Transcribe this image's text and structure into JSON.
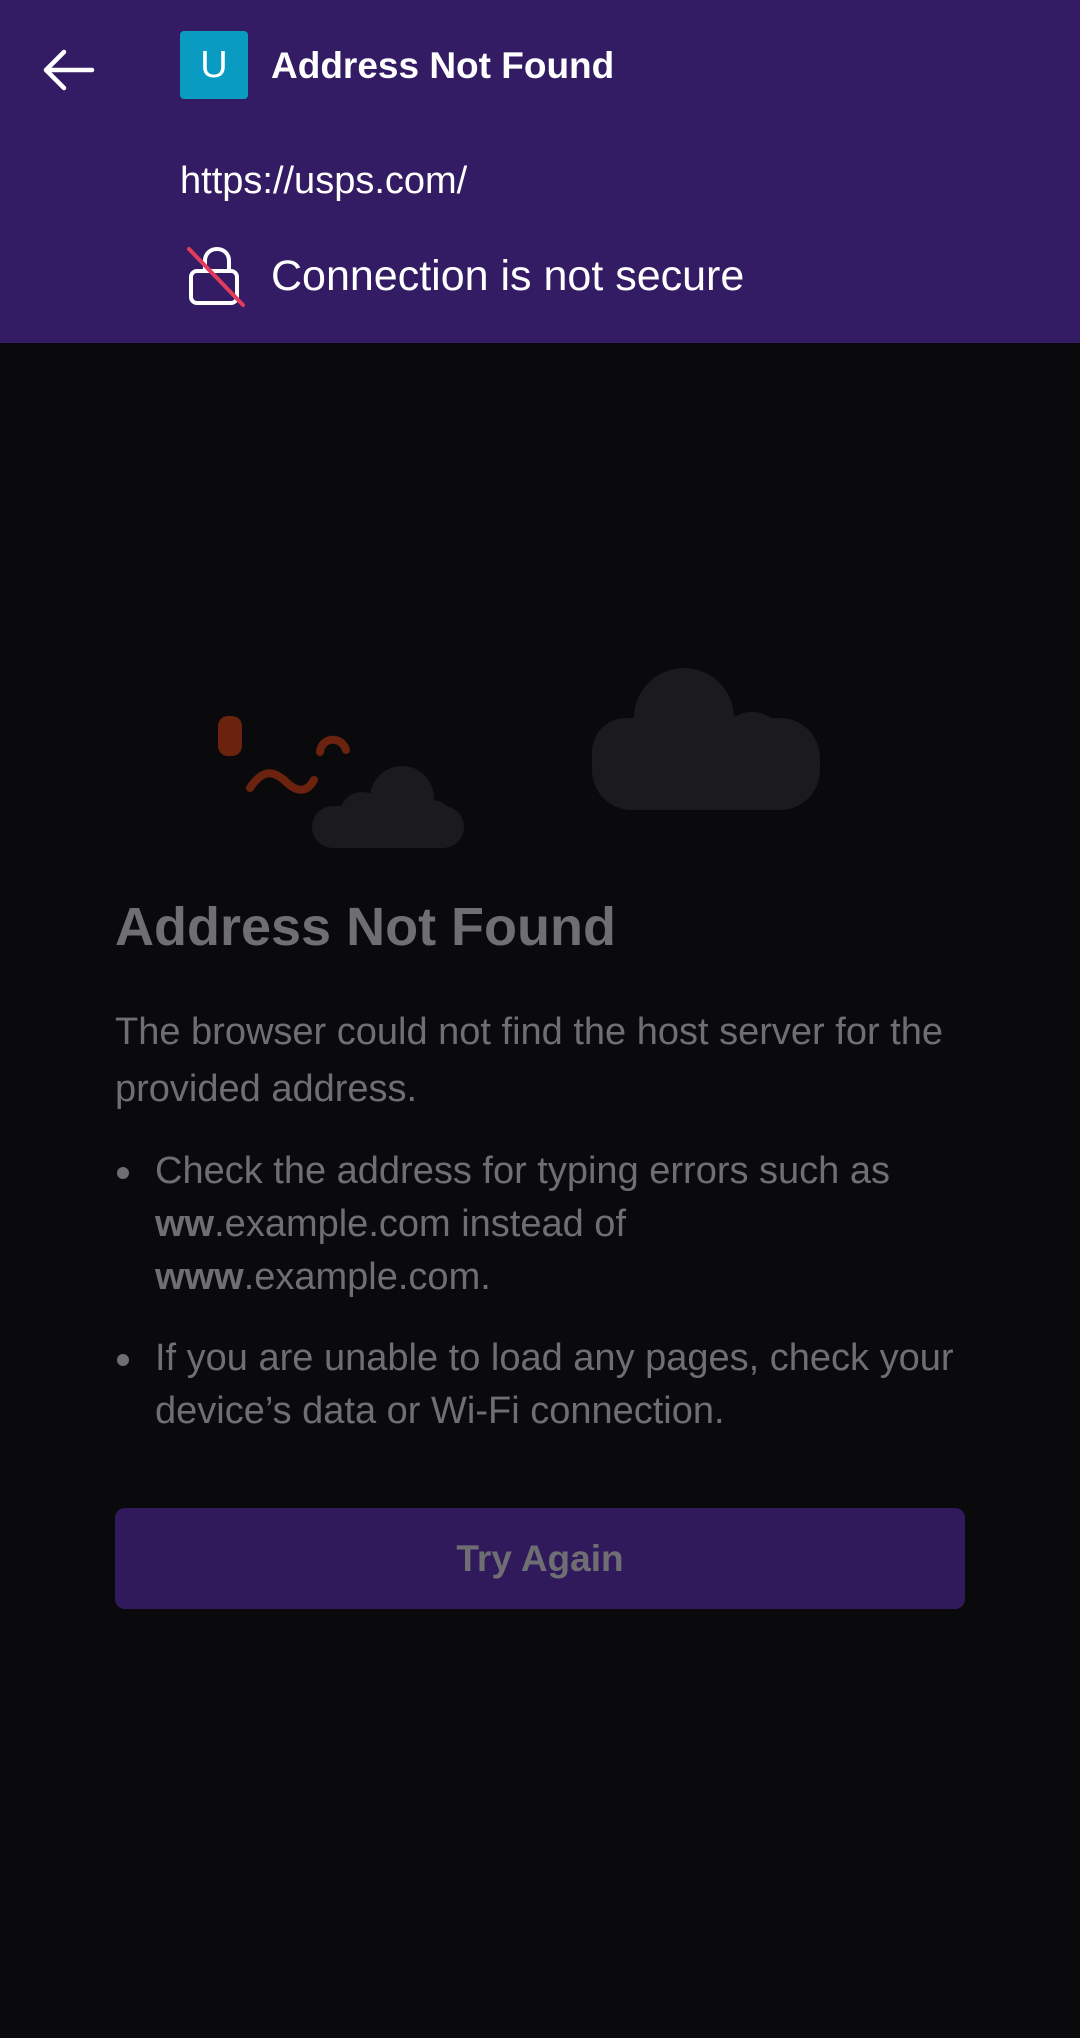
{
  "header": {
    "back_icon": "arrow-left-icon",
    "site_icon_letter": "U",
    "site_icon_color": "#0a9bc3",
    "title": "Address Not Found",
    "url": "https://usps.com/",
    "security_icon": "insecure-lock-icon",
    "security_text": "Connection is not secure",
    "background_color": "#331c63"
  },
  "error_page": {
    "title": "Address Not Found",
    "description": "The browser could not find the host server for the provided address.",
    "bullet1": {
      "line1": "Check the address for typing errors such as",
      "bold_a": "ww",
      "text_a": ".example.com instead of",
      "bold_b": "www",
      "text_b": ".example.com."
    },
    "bullet2": "If you are unable to load any pages, check your device’s data or Wi-Fi connection.",
    "button_label": "Try Again",
    "accent_color": "#301a5c"
  }
}
